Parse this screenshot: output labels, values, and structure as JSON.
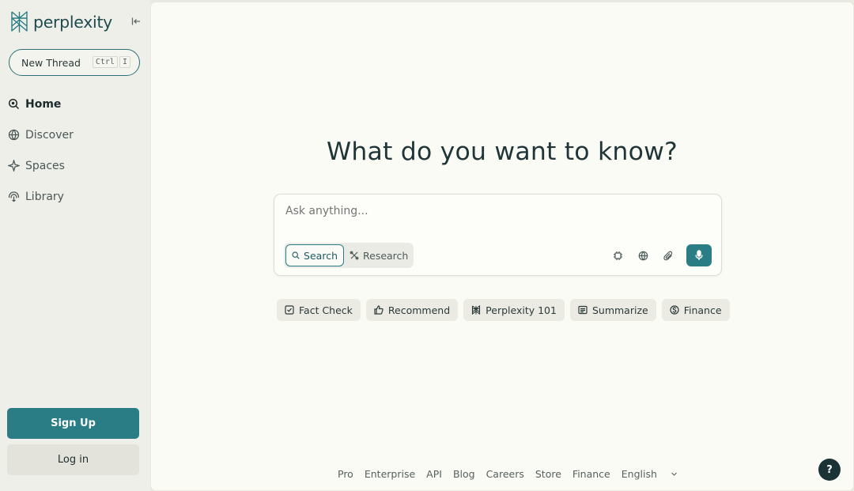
{
  "brand": {
    "name": "perplexity"
  },
  "sidebar": {
    "new_thread": "New Thread",
    "shortcut": [
      "Ctrl",
      "I"
    ],
    "items": [
      {
        "label": "Home",
        "icon": "search-icon",
        "active": true
      },
      {
        "label": "Discover",
        "icon": "globe-icon",
        "active": false
      },
      {
        "label": "Spaces",
        "icon": "sparkle-icon",
        "active": false
      },
      {
        "label": "Library",
        "icon": "library-icon",
        "active": false
      }
    ],
    "sign_up": "Sign Up",
    "log_in": "Log in"
  },
  "main": {
    "heading": "What do you want to know?",
    "ask": {
      "placeholder": "Ask anything...",
      "modes": [
        {
          "label": "Search",
          "active": true
        },
        {
          "label": "Research",
          "active": false
        }
      ]
    },
    "chips": [
      {
        "label": "Fact Check",
        "icon": "check-square-icon"
      },
      {
        "label": "Recommend",
        "icon": "thumbs-up-icon"
      },
      {
        "label": "Perplexity 101",
        "icon": "perplexity-icon"
      },
      {
        "label": "Summarize",
        "icon": "list-icon"
      },
      {
        "label": "Finance",
        "icon": "dollar-icon"
      }
    ]
  },
  "footer": {
    "links": [
      "Pro",
      "Enterprise",
      "API",
      "Blog",
      "Careers",
      "Store",
      "Finance",
      "English"
    ]
  },
  "help": "?",
  "colors": {
    "accent": "#2a7c85",
    "dark": "#1c3336",
    "sidebar_bg": "#efefe9",
    "main_bg": "#fbfbf5"
  }
}
